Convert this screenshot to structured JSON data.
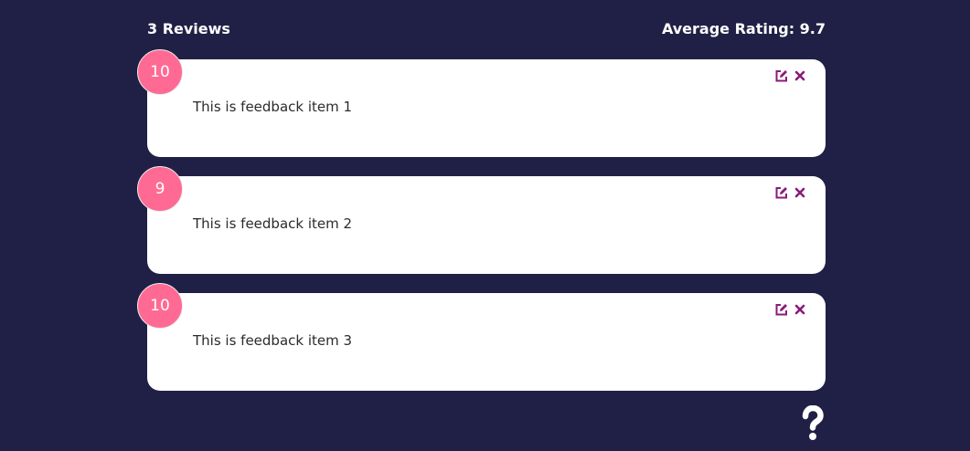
{
  "stats": {
    "review_count": "3 Reviews",
    "average_rating": "Average Rating: 9.7"
  },
  "feedback": [
    {
      "rating": "10",
      "text": "This is feedback item 1"
    },
    {
      "rating": "9",
      "text": "This is feedback item 2"
    },
    {
      "rating": "10",
      "text": "This is feedback item 3"
    }
  ],
  "icons": {
    "edit": "edit-icon",
    "close": "close-icon",
    "help": "question-icon"
  },
  "colors": {
    "background": "#202046",
    "card": "#ffffff",
    "rating_badge": "#ff6a95",
    "action_icons": "#8a1a7a"
  }
}
